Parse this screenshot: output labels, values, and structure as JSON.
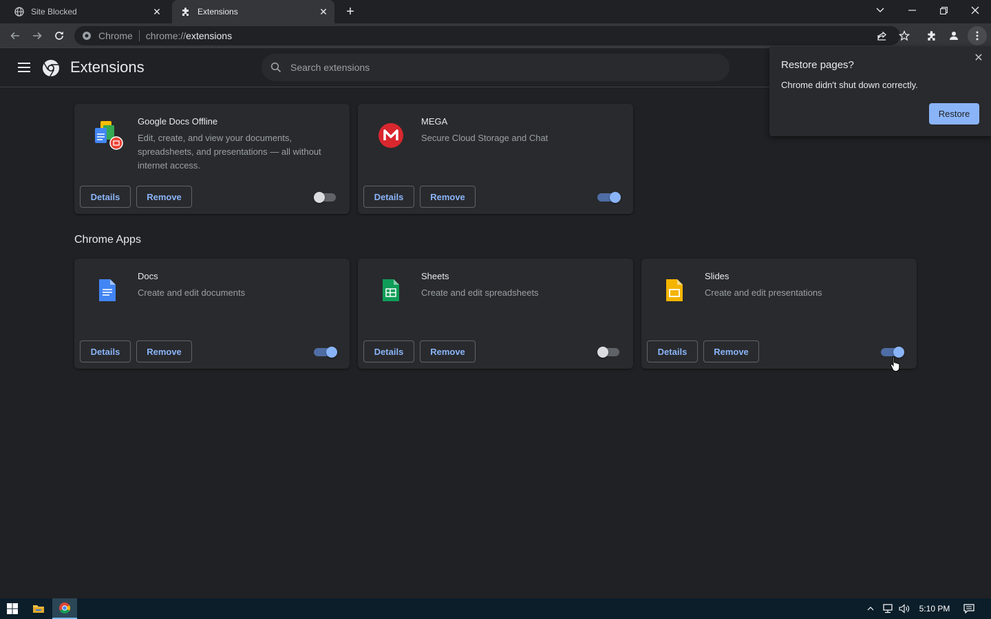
{
  "window": {
    "tabs": [
      {
        "label": "Site Blocked",
        "icon": "globe-icon"
      },
      {
        "label": "Extensions",
        "icon": "puzzle-icon"
      }
    ]
  },
  "toolbar": {
    "site_chip": "Chrome",
    "url_scheme": "chrome://",
    "url_path": "extensions"
  },
  "header": {
    "title": "Extensions",
    "search_placeholder": "Search extensions"
  },
  "extensions": [
    {
      "name": "Google Docs Offline",
      "description": "Edit, create, and view your documents, spreadsheets, and presentations — all without internet access.",
      "enabled": false,
      "details_label": "Details",
      "remove_label": "Remove"
    },
    {
      "name": "MEGA",
      "description": "Secure Cloud Storage and Chat",
      "enabled": true,
      "details_label": "Details",
      "remove_label": "Remove"
    }
  ],
  "apps_section_title": "Chrome Apps",
  "apps": [
    {
      "name": "Docs",
      "description": "Create and edit documents",
      "enabled": true,
      "details_label": "Details",
      "remove_label": "Remove"
    },
    {
      "name": "Sheets",
      "description": "Create and edit spreadsheets",
      "enabled": false,
      "details_label": "Details",
      "remove_label": "Remove"
    },
    {
      "name": "Slides",
      "description": "Create and edit presentations",
      "enabled": true,
      "details_label": "Details",
      "remove_label": "Remove"
    }
  ],
  "restore_popup": {
    "title": "Restore pages?",
    "body": "Chrome didn't shut down correctly.",
    "button": "Restore"
  },
  "taskbar": {
    "clock": "5:10 PM"
  },
  "colors": {
    "accent": "#8ab4f8",
    "background": "#202124",
    "card": "#292a2d"
  }
}
